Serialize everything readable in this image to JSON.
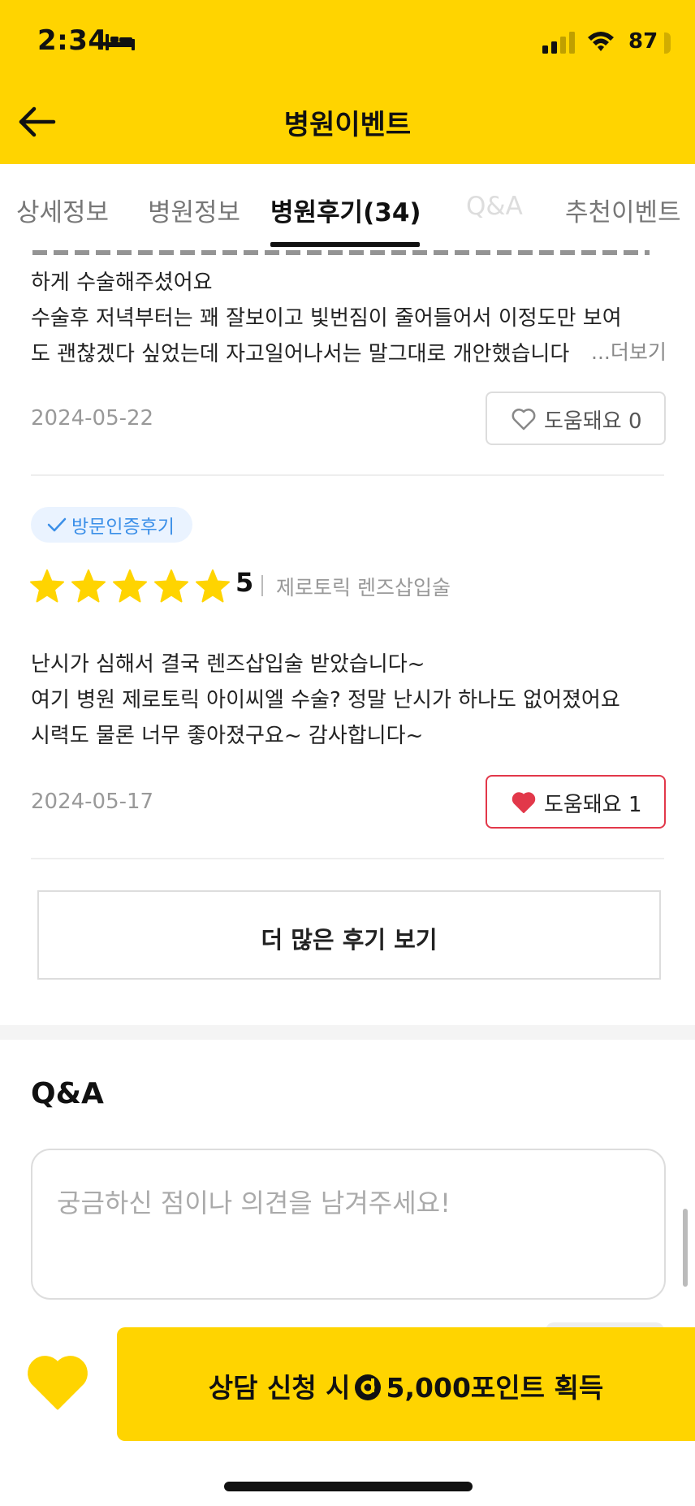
{
  "status_bar": {
    "time": "2:34",
    "battery": "87"
  },
  "nav": {
    "title": "병원이벤트"
  },
  "tabs": [
    {
      "label": "상세정보",
      "state": "normal"
    },
    {
      "label": "병원정보",
      "state": "normal"
    },
    {
      "label": "병원후기(34)",
      "state": "active"
    },
    {
      "label": "Q&A",
      "state": "faded"
    },
    {
      "label": "추천이벤트",
      "state": "normal"
    }
  ],
  "review1": {
    "lines": [
      "하게 수술해주셨어요",
      "수술후 저녁부터는 꽤 잘보이고 빛번짐이 줄어들어서 이정도만 보여",
      "도 괜찮겠다 싶었는데 자고일어나서는 말그대로 개안했습니다"
    ],
    "more": "...더보기",
    "date": "2024-05-22",
    "helpful_label": "도움돼요",
    "helpful_count": "0"
  },
  "review2": {
    "badge": "방문인증후기",
    "rating": "5",
    "stars": 5,
    "procedure": "제로토릭 렌즈삽입술",
    "lines": [
      "난시가 심해서 결국 렌즈삽입술 받았습니다~",
      "여기 병원 제로토릭 아이씨엘 수술? 정말 난시가 하나도 없어졌어요",
      "시력도 물론 너무 좋아졌구요~ 감사합니다~"
    ],
    "date": "2024-05-17",
    "helpful_label": "도움돼요",
    "helpful_count": "1"
  },
  "more_reviews_button": "더 많은 후기 보기",
  "qa": {
    "title": "Q&A",
    "placeholder": "궁금하신 점이나 의견을 남겨주세요!"
  },
  "cta": {
    "prefix": "상담 신청 시",
    "points": "5,000포인트 획득"
  },
  "colors": {
    "brand_yellow": "#FFD400",
    "heart_red": "#E2384A",
    "badge_blue": "#3B8FE8",
    "star_yellow": "#FFD400"
  }
}
